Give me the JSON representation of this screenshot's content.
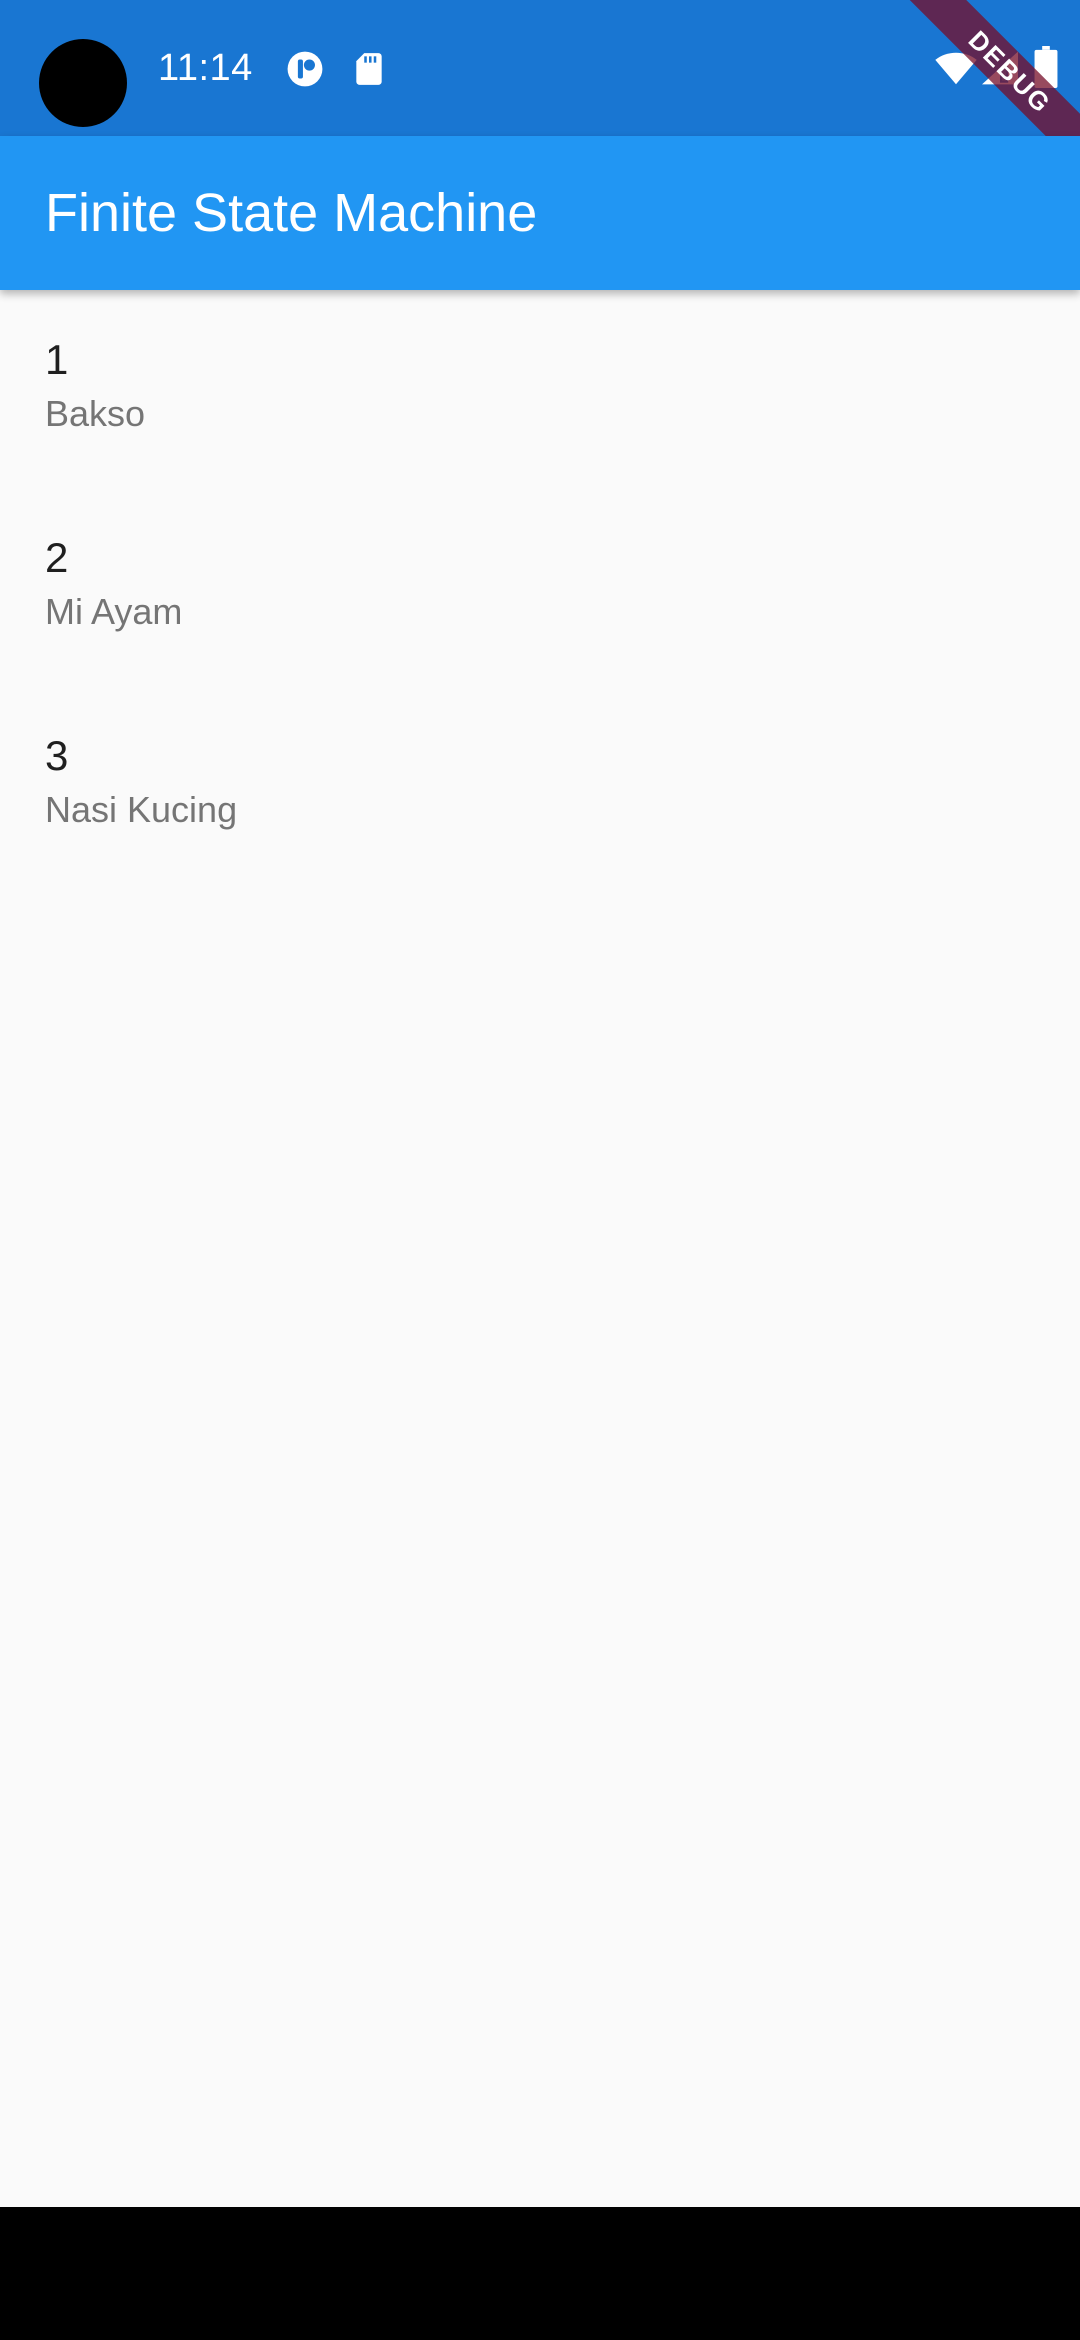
{
  "status_bar": {
    "time": "11:14",
    "icons": [
      "app-notification-icon",
      "sd-card-icon",
      "wifi-icon",
      "signal-icon",
      "battery-icon"
    ],
    "background": "#1976D2"
  },
  "debug_banner": {
    "label": "DEBUG"
  },
  "app_bar": {
    "title": "Finite State Machine",
    "background": "#2196F3"
  },
  "list": {
    "items": [
      {
        "title": "1",
        "subtitle": "Bakso"
      },
      {
        "title": "2",
        "subtitle": "Mi Ayam"
      },
      {
        "title": "3",
        "subtitle": "Nasi Kucing"
      }
    ]
  }
}
